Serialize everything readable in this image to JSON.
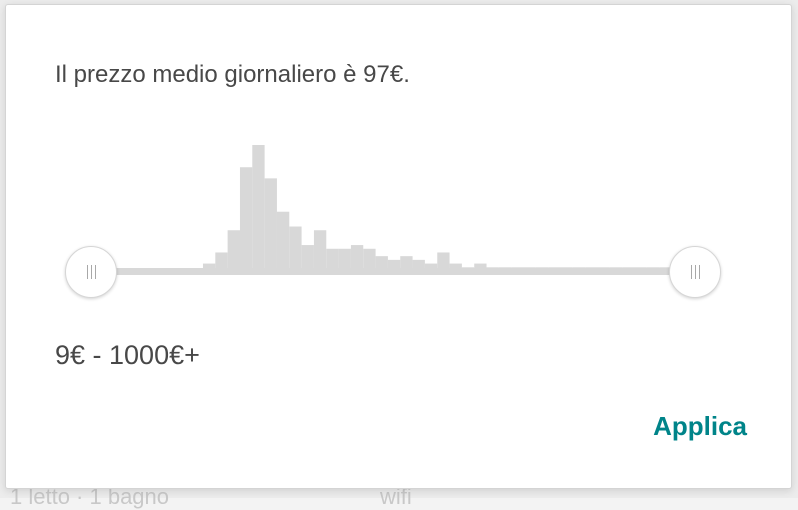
{
  "background": {
    "fragments": [
      "1 letto · 1 bagno",
      "wifi"
    ]
  },
  "price_filter": {
    "average_text": "Il prezzo medio giornaliero è 97€.",
    "range_label": "9€ - 1000€+",
    "min_handle_icon": "grip-lines-icon",
    "max_handle_icon": "grip-lines-icon",
    "apply_label": "Applica",
    "accent_color": "#008489",
    "histogram_color": "#d8d8d8"
  },
  "chart_data": {
    "type": "bar",
    "title": "",
    "xlabel": "",
    "ylabel": "",
    "categories": [],
    "values": [
      0,
      0,
      0,
      0,
      0,
      0,
      0,
      0,
      0,
      2,
      5,
      11,
      28,
      34,
      25,
      16,
      12,
      7,
      11,
      6,
      6,
      7,
      6,
      4,
      3,
      4,
      3,
      2,
      5,
      2,
      1,
      2,
      1,
      1,
      1,
      1,
      1,
      1,
      1,
      1,
      1,
      1,
      1,
      1,
      1,
      1,
      1,
      1,
      1
    ],
    "ylim": [
      0,
      34
    ]
  }
}
